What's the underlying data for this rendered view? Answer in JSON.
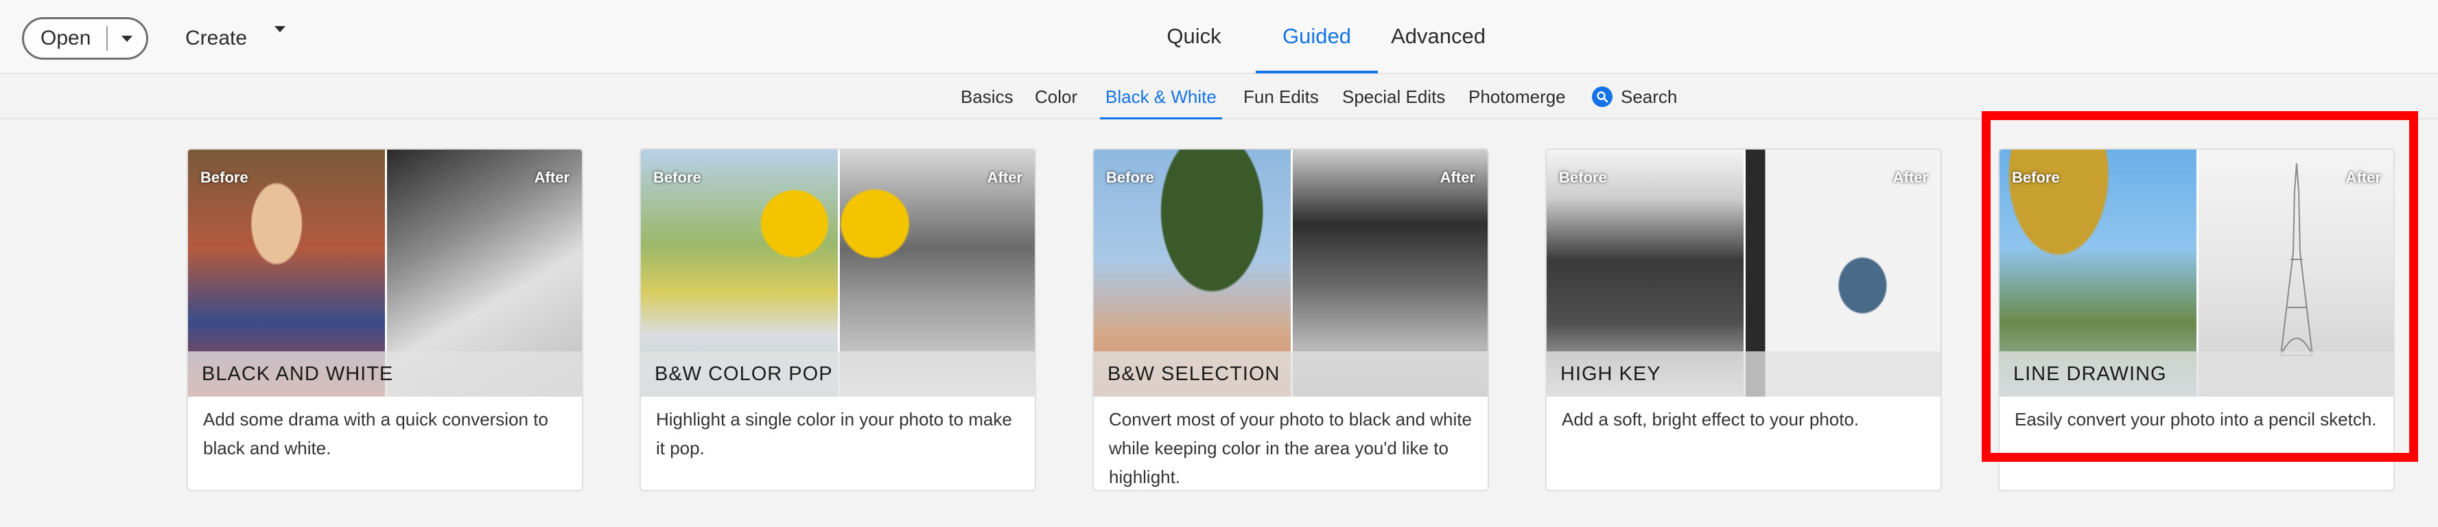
{
  "toolbar": {
    "open_label": "Open",
    "create_label": "Create"
  },
  "modes": [
    {
      "label": "Quick"
    },
    {
      "label": "Guided"
    },
    {
      "label": "Advanced"
    }
  ],
  "categories": [
    {
      "label": "Basics"
    },
    {
      "label": "Color"
    },
    {
      "label": "Black & White"
    },
    {
      "label": "Fun Edits"
    },
    {
      "label": "Special Edits"
    },
    {
      "label": "Photomerge"
    },
    {
      "label": "Search"
    }
  ],
  "cards": [
    {
      "title": "BLACK AND WHITE",
      "desc": "Add some drama with a quick conversion to black and white.",
      "before": "Before",
      "after": "After"
    },
    {
      "title": "B&W COLOR POP",
      "desc": "Highlight a single color in your photo to make it pop.",
      "before": "Before",
      "after": "After"
    },
    {
      "title": "B&W SELECTION",
      "desc": "Convert most of your photo to black and white while keeping color in the area you'd like to highlight.",
      "before": "Before",
      "after": "After"
    },
    {
      "title": "HIGH KEY",
      "desc": "Add a soft, bright effect to your photo.",
      "before": "Before",
      "after": "After"
    },
    {
      "title": "LINE DRAWING",
      "desc": "Easily convert your photo into a pencil sketch.",
      "before": "Before",
      "after": "After"
    }
  ],
  "colors": {
    "accent": "#1473e6",
    "highlight": "#ff0000"
  }
}
